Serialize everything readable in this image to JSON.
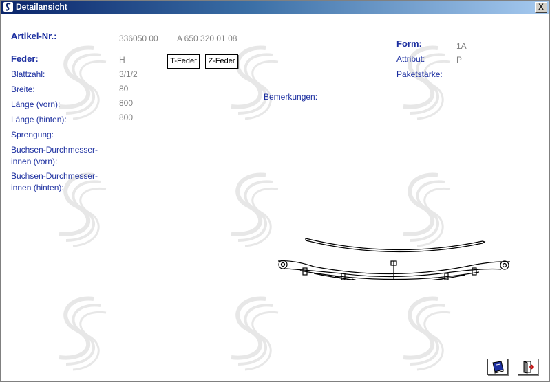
{
  "window": {
    "title": "Detailansicht",
    "close_label": "X"
  },
  "artikel": {
    "label": "Artikel-Nr.:",
    "number": "336050 00",
    "ref": "A 650 320 01 08"
  },
  "feder": {
    "label": "Feder:",
    "value": "H"
  },
  "buttons": {
    "t_feder": "T-Feder",
    "z_feder": "Z-Feder"
  },
  "fields": [
    {
      "label": "Blattzahl:",
      "value": "3/1/2"
    },
    {
      "label": "Breite:",
      "value": "80"
    },
    {
      "label": "Länge (vorn):",
      "value": "800"
    },
    {
      "label": "Länge (hinten):",
      "value": "800"
    },
    {
      "label": "Sprengung:",
      "value": ""
    }
  ],
  "bushings": {
    "vorn_line1": "Buchsen-Durchmesser-",
    "vorn_line2": "innen (vorn):",
    "hinten_line1": "Buchsen-Durchmesser-",
    "hinten_line2": "innen (hinten):"
  },
  "bemerkungen": {
    "label": "Bemerkungen:"
  },
  "right": {
    "form_label": "Form:",
    "form_value": "1A",
    "attribut_label": "Attribut:",
    "attribut_value": "P",
    "paket_label": "Paketstärke:"
  },
  "icons": {
    "book": "book-icon",
    "exit": "exit-door-icon",
    "app": "app-logo-icon"
  },
  "colors": {
    "label": "#1c2fa0",
    "value": "#808080",
    "title_start": "#0a246a",
    "title_end": "#a6caf0"
  }
}
